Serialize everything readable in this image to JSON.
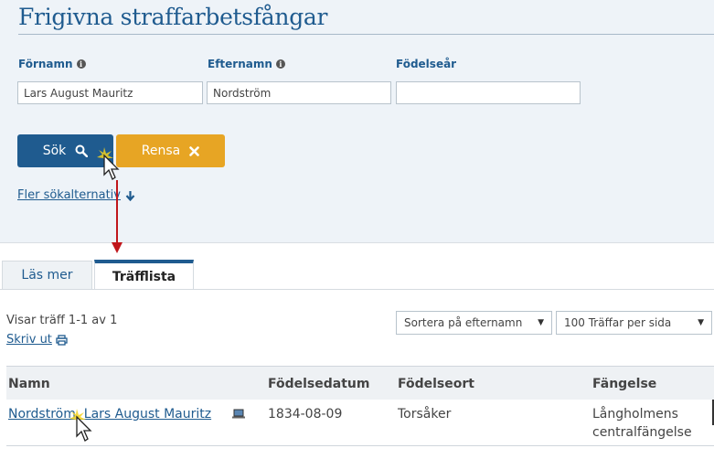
{
  "search": {
    "title": "Frigivna straffarbetsfångar",
    "first_name_label": "Förnamn",
    "last_name_label": "Efternamn",
    "birth_year_label": "Födelseår",
    "first_name_value": "Lars August Mauritz",
    "last_name_value": "Nordström",
    "birth_year_value": "",
    "search_button": "Sök",
    "clear_button": "Rensa",
    "more_options": "Fler sökalternativ"
  },
  "tabs": [
    {
      "label": "Läs mer",
      "active": false
    },
    {
      "label": "Träfflista",
      "active": true
    }
  ],
  "results": {
    "count_text": "Visar träff 1-1 av 1",
    "print_label": "Skriv ut",
    "sort_select": "Sortera på efternamn",
    "per_page_select": "100 Träffar per sida",
    "columns": [
      "Namn",
      "Födelsedatum",
      "Födelseort",
      "Fängelse"
    ],
    "rows": [
      {
        "name": "Nordström, Lars August Mauritz",
        "birth_date": "1834-08-09",
        "birth_place": "Torsåker",
        "prison_line1": "Långholmens",
        "prison_line2": "centralfängelse"
      }
    ]
  },
  "colors": {
    "primary": "#1f5b8f",
    "accent": "#e7a524",
    "panel": "#eef3f8",
    "arrow": "#c0161b"
  },
  "icons": [
    "info-icon",
    "search-icon",
    "close-icon",
    "arrow-down-icon",
    "printer-icon",
    "laptop-icon",
    "cursor-icon"
  ]
}
